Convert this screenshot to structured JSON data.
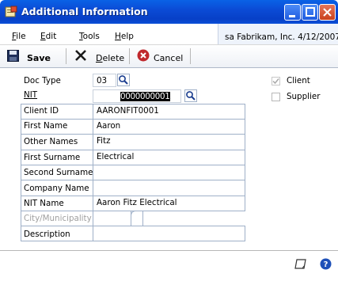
{
  "window": {
    "title": "Additional Information"
  },
  "menu": {
    "file": {
      "underline": "F",
      "rest": "ile"
    },
    "edit": {
      "underline": "E",
      "rest": "dit"
    },
    "tools": {
      "underline": "T",
      "rest": "ools"
    },
    "help": {
      "underline": "H",
      "rest": "elp"
    }
  },
  "company_info": "sa  Fabrikam, Inc.  4/12/2007",
  "toolbar": {
    "save_label": "Save",
    "delete_underline": "D",
    "delete_rest": "elete",
    "cancel_label": "Cancel"
  },
  "form": {
    "doc_type": {
      "label": "Doc Type",
      "value": "03"
    },
    "nit": {
      "label": "NIT",
      "value": "0000000001"
    },
    "client_id": {
      "label": "Client ID",
      "value": "AARONFIT0001"
    },
    "first_name": {
      "label": "First Name",
      "value": "Aaron"
    },
    "other_names": {
      "label": "Other Names",
      "value": "Fitz"
    },
    "first_surname": {
      "label": "First Surname",
      "value": "Electrical"
    },
    "second_surname": {
      "label": "Second Surname",
      "value": ""
    },
    "company_name": {
      "label": "Company Name",
      "value": ""
    },
    "nit_name": {
      "label": "NIT Name",
      "value": "Aaron Fitz Electrical"
    },
    "city": {
      "label": "City/Municipality",
      "value": ""
    },
    "description": {
      "label": "Description",
      "value": ""
    }
  },
  "checkboxes": {
    "client": {
      "label": "Client",
      "checked": true,
      "disabled": true
    },
    "supplier": {
      "label": "Supplier",
      "checked": false,
      "disabled": false
    }
  },
  "icons": {
    "title": "form-icon",
    "save": "save-disk-icon",
    "delete": "delete-x-icon",
    "cancel": "cancel-circle-icon",
    "lookup": "magnifier-lookup-icon",
    "note": "note-icon",
    "help": "help-icon"
  },
  "colors": {
    "titlebar": "#0b4bd6",
    "grid_border": "#9fb0c8",
    "cancel_red": "#c0282d"
  }
}
